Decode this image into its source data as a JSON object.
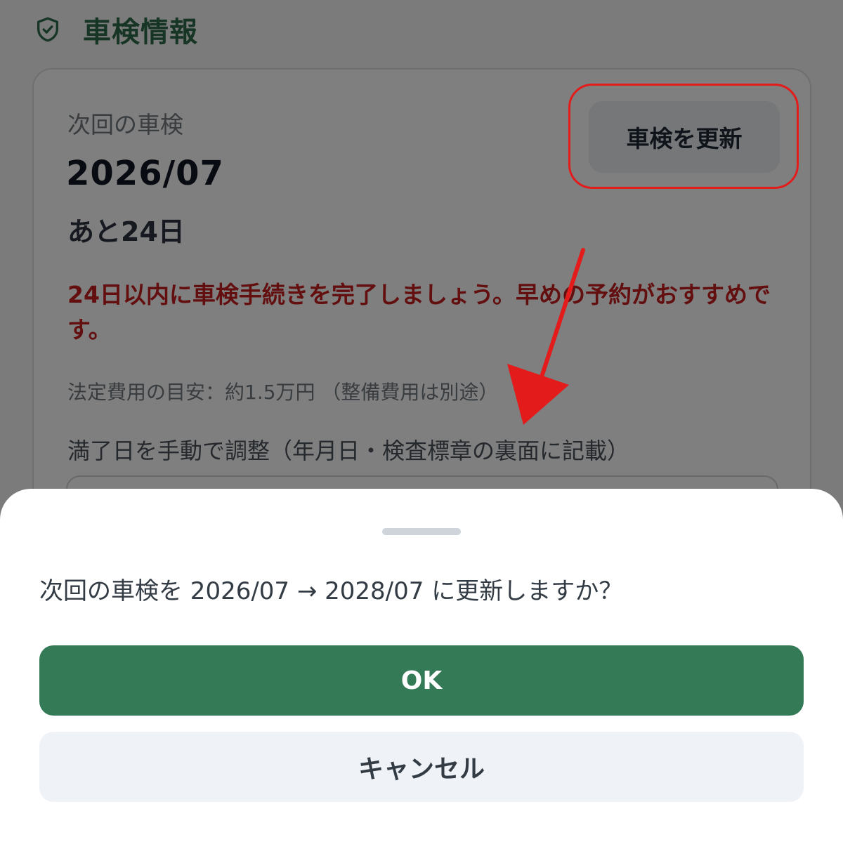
{
  "section": {
    "title": "車検情報",
    "icon": "shield-check-icon"
  },
  "card": {
    "label": "次回の車検",
    "date": "2026/07",
    "remaining": "あと24日",
    "warning": "24日以内に車検手続きを完了しましょう。早めの予約がおすすめです。",
    "fee_note": "法定費用の目安：約1.5万円 （整備費用は別途）",
    "adjust_label": "満了日を手動で調整（年月日・検査標章の裏面に記載）",
    "renew_button": "車検を更新"
  },
  "dialog": {
    "message": "次回の車検を 2026/07 → 2028/07 に更新しますか？",
    "ok_label": "OK",
    "cancel_label": "キャンセル"
  },
  "colors": {
    "brand_green": "#357a57",
    "warning_red": "#c81e1e",
    "annotation_red": "#e31b1b"
  }
}
